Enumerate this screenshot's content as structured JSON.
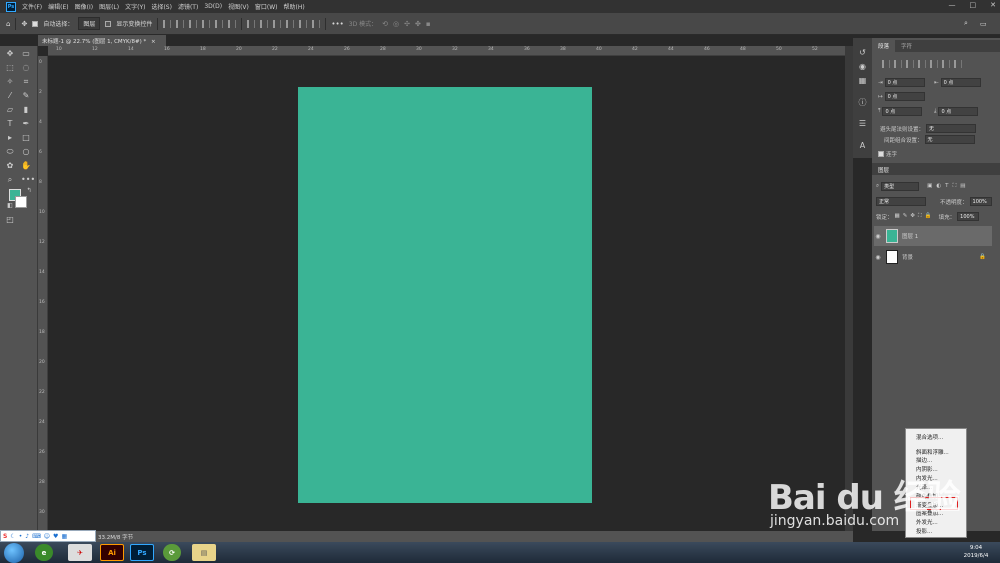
{
  "menubar": {
    "logo": "Ps",
    "items": [
      "文件(F)",
      "编辑(E)",
      "图像(I)",
      "图层(L)",
      "文字(Y)",
      "选择(S)",
      "滤镜(T)",
      "3D(D)",
      "视图(V)",
      "窗口(W)",
      "帮助(H)"
    ],
    "window_controls": [
      "—",
      "□",
      "✕"
    ]
  },
  "options": {
    "auto_select_label": "自动选择：",
    "auto_select_value": "图层",
    "show_transform_label": "显示变换控件",
    "mode_label": "3D 模式："
  },
  "document": {
    "tab_title": "未标题-1 @ 22.7% (图层 1, CMYK/8#) *",
    "status": "33.2M/8 字节",
    "artboard_color": "#3ab495"
  },
  "ruler": {
    "top_ticks": [
      "10",
      "12",
      "14",
      "16",
      "18",
      "20",
      "22",
      "24",
      "26",
      "28",
      "30",
      "32",
      "34",
      "36",
      "38",
      "40",
      "42",
      "44",
      "46",
      "48",
      "50",
      "52"
    ],
    "left_ticks": [
      "0",
      "2",
      "4",
      "6",
      "8",
      "10",
      "12",
      "14",
      "16",
      "18",
      "20",
      "22",
      "24",
      "26",
      "28",
      "30"
    ]
  },
  "colors": {
    "foreground": "#3ab495",
    "background": "#ffffff"
  },
  "paragraph_panel": {
    "tabs": [
      "段落",
      "字符"
    ],
    "indent_left": "0 点",
    "indent_right": "0 点",
    "indent_first": "0 点",
    "space_before": "0 点",
    "space_after": "0 点",
    "kinsoku_label": "避头尾法则设置：",
    "kinsoku_value": "无",
    "mojikumi_label": "间距组合设置：",
    "mojikumi_value": "无",
    "hyphenate_label": "连字"
  },
  "layers_panel": {
    "title": "图层",
    "filter_label": "类型",
    "blend_mode": "正常",
    "opacity_label": "不透明度：",
    "opacity_value": "100%",
    "lock_label": "锁定：",
    "fill_label": "填充：",
    "fill_value": "100%",
    "layers": [
      {
        "name": "图层 1",
        "color": "#3ab495",
        "selected": true
      },
      {
        "name": "背景",
        "color": "#ffffff",
        "selected": false
      }
    ]
  },
  "context_menu": {
    "items": [
      "混合选项...",
      "斜面和浮雕...",
      "描边...",
      "内阴影...",
      "内发光...",
      "光泽...",
      "颜色叠加...",
      "渐变叠加...",
      "图案叠加...",
      "外发光...",
      "投影..."
    ]
  },
  "taskbar": {
    "apps": [
      "Ai",
      "Ps"
    ],
    "time": "9:04",
    "date": "2019/6/4"
  },
  "watermark": {
    "brand": "Bai du 经验",
    "url": "jingyan.baidu.com"
  }
}
